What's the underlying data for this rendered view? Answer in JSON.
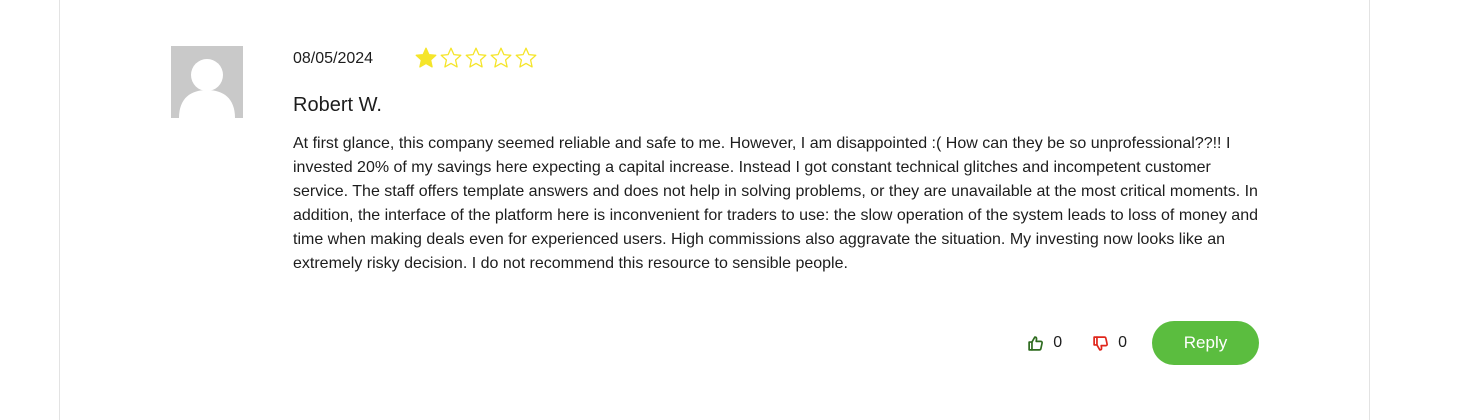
{
  "review": {
    "date": "08/05/2024",
    "rating": 1,
    "rating_max": 5,
    "author": "Robert W.",
    "text": "At first glance, this company seemed reliable and safe to me. However, I am disappointed :( How can they be so unprofessional??!! I invested 20% of my savings here expecting a capital increase. Instead I got constant technical glitches and incompetent customer service. The staff offers template answers and does not help in solving problems, or they are unavailable at the most critical moments. In addition, the interface of the platform here is inconvenient for traders to use: the slow operation of the system leads to loss of money and time when making deals even for experienced users. High commissions also aggravate the situation. My investing now looks like an extremely risky decision. I do not recommend this resource to sensible people.",
    "likes": "0",
    "dislikes": "0",
    "reply_label": "Reply"
  },
  "icons": {
    "avatar": "user-silhouette-icon",
    "star_filled": "star-filled-icon",
    "star_empty": "star-outline-icon",
    "like": "thumbs-up-icon",
    "dislike": "thumbs-down-icon"
  },
  "colors": {
    "star": "#f5e52a",
    "like": "#2e6b1f",
    "dislike": "#e0261b",
    "reply_button": "#5bbd3f",
    "avatar_bg": "#c9c9c9"
  }
}
